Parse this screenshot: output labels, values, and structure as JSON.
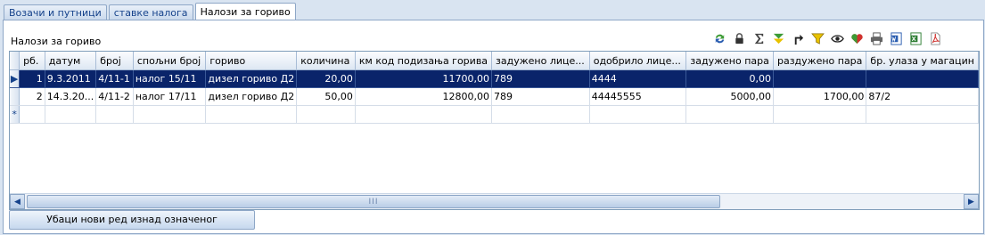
{
  "tabs": [
    {
      "label": "Возачи и путници",
      "active": false
    },
    {
      "label": "ставке налога",
      "active": false
    },
    {
      "label": "Налози за гориво",
      "active": true
    }
  ],
  "panel": {
    "title": "Налози за гориво"
  },
  "toolbar": {
    "icons": [
      "refresh-icon",
      "lock-icon",
      "sum-icon",
      "download-arrows-icon",
      "turn-arrow-icon",
      "filter-icon",
      "eye-icon",
      "heart-icon",
      "print-icon",
      "word-icon",
      "excel-icon",
      "pdf-icon"
    ],
    "colors": {
      "green": "#3d9b35",
      "dark": "#333333",
      "red": "#d0312d",
      "yellow": "#e8c200",
      "blue": "#2a5db0"
    }
  },
  "grid": {
    "columns": [
      "рб.",
      "датум",
      "број",
      "спољни број",
      "гориво",
      "количина",
      "км код подизања горива",
      "задужено лице...",
      "одобрило лице...",
      "задужено пара",
      "раздужено пара",
      "бр. улаза у магацин"
    ],
    "rows": [
      {
        "selected": true,
        "cells": [
          "1",
          "9.3.2011",
          "4/11-1",
          "налог 15/11",
          "дизел гориво Д2",
          "20,00",
          "11700,00",
          "789",
          "4444",
          "0,00",
          "",
          ""
        ]
      },
      {
        "selected": false,
        "cells": [
          "2",
          "14.3.20...",
          "4/11-2",
          "налог 17/11",
          "дизел гориво Д2",
          "50,00",
          "12800,00",
          "789",
          "44445555",
          "5000,00",
          "1700,00",
          "87/2"
        ]
      }
    ],
    "new_row_marker": "*",
    "selected_marker": "▶",
    "scroll_grip": "III"
  },
  "insert_button": "Убаци нови ред изнад означеног"
}
